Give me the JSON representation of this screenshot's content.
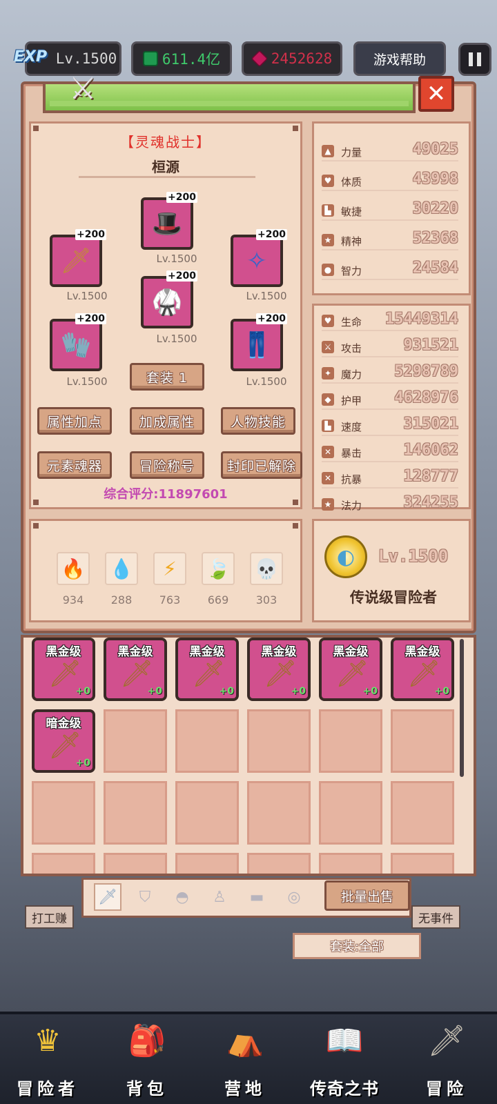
{
  "hud": {
    "exp_tag": "EXP",
    "level": "Lv.1500",
    "gold": "611.4亿",
    "gems": "2452628",
    "help_button": "游戏帮助"
  },
  "hero": {
    "class_name": "【灵魂战士】",
    "name": "桓源",
    "equipment": [
      {
        "slot": "weapon",
        "icon": "sword-icon",
        "bonus": "+200",
        "level": "Lv.1500"
      },
      {
        "slot": "helmet",
        "icon": "helmet-icon",
        "bonus": "+200",
        "level": "Lv.1500"
      },
      {
        "slot": "necklace",
        "icon": "amulet-icon",
        "bonus": "+200",
        "level": "Lv.1500"
      },
      {
        "slot": "armor",
        "icon": "armor-icon",
        "bonus": "+200",
        "level": "Lv.1500"
      },
      {
        "slot": "gloves",
        "icon": "gloves-icon",
        "bonus": "+200",
        "level": "Lv.1500"
      },
      {
        "slot": "pants",
        "icon": "pants-icon",
        "bonus": "+200",
        "level": "Lv.1500"
      }
    ],
    "set_button": "套装 1",
    "buttons": [
      "属性加点",
      "加成属性",
      "人物技能",
      "元素魂器",
      "冒险称号",
      "封印已解除"
    ],
    "score": "综合评分:11897601"
  },
  "elements": [
    {
      "icon": "fire-icon",
      "value": "934"
    },
    {
      "icon": "water-icon",
      "value": "288"
    },
    {
      "icon": "lightning-icon",
      "value": "763"
    },
    {
      "icon": "wind-icon",
      "value": "669"
    },
    {
      "icon": "dark-icon",
      "value": "303"
    }
  ],
  "base_stats": [
    {
      "label": "力量",
      "value": "49025"
    },
    {
      "label": "体质",
      "value": "43998"
    },
    {
      "label": "敏捷",
      "value": "30220"
    },
    {
      "label": "精神",
      "value": "52368"
    },
    {
      "label": "智力",
      "value": "24584"
    }
  ],
  "combat_stats": [
    {
      "label": "生命",
      "value": "15449314"
    },
    {
      "label": "攻击",
      "value": "931521"
    },
    {
      "label": "魔力",
      "value": "5298789"
    },
    {
      "label": "护甲",
      "value": "4628976"
    },
    {
      "label": "速度",
      "value": "315021"
    },
    {
      "label": "暴击",
      "value": "146062"
    },
    {
      "label": "抗暴",
      "value": "128777"
    },
    {
      "label": "法力",
      "value": "324255"
    }
  ],
  "rank": {
    "level": "Lv.1500",
    "title": "传说级冒险者"
  },
  "inventory": [
    {
      "tier": "黑金级",
      "enhance": "+0"
    },
    {
      "tier": "黑金级",
      "enhance": "+0"
    },
    {
      "tier": "黑金级",
      "enhance": "+0"
    },
    {
      "tier": "黑金级",
      "enhance": "+0"
    },
    {
      "tier": "黑金级",
      "enhance": "+0"
    },
    {
      "tier": "黑金级",
      "enhance": "+0"
    },
    {
      "tier": "暗金级",
      "enhance": "+0"
    }
  ],
  "tabs": [
    "sword-icon",
    "shield-icon",
    "helmet-icon",
    "armor-icon",
    "belt-icon",
    "ring-icon"
  ],
  "bulk_sell": "批量出售",
  "set_filter": "套装:全部",
  "background_labels": {
    "left": "打工赚",
    "right": "无事件"
  },
  "nav": [
    {
      "icon": "crown-icon",
      "label": "冒险者"
    },
    {
      "icon": "backpack-icon",
      "label": "背包"
    },
    {
      "icon": "camp-icon",
      "label": "营地"
    },
    {
      "icon": "book-icon",
      "label": "传奇之书"
    },
    {
      "icon": "sword-icon",
      "label": "冒险"
    }
  ]
}
